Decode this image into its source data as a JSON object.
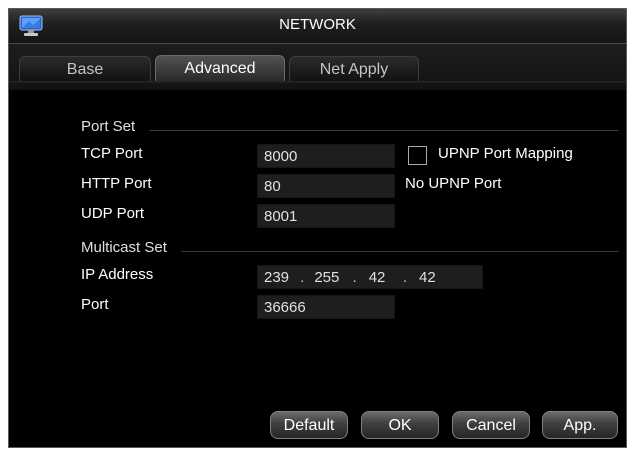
{
  "window": {
    "title": "NETWORK",
    "icon": "network-monitor-icon"
  },
  "tabs": [
    {
      "label": "Base",
      "active": false
    },
    {
      "label": "Advanced",
      "active": true
    },
    {
      "label": "Net Apply",
      "active": false
    }
  ],
  "port_set": {
    "section_label": "Port Set",
    "tcp_port": {
      "label": "TCP Port",
      "value": "8000"
    },
    "http_port": {
      "label": "HTTP Port",
      "value": "80"
    },
    "udp_port": {
      "label": "UDP Port",
      "value": "8001"
    },
    "upnp": {
      "checkbox_label": "UPNP Port Mapping",
      "checked": false,
      "status_text": "No UPNP Port"
    }
  },
  "multicast_set": {
    "section_label": "Multicast Set",
    "ip_address": {
      "label": "IP Address",
      "octets": [
        "239",
        "255",
        "42",
        "42"
      ],
      "separator": "."
    },
    "port": {
      "label": "Port",
      "value": "36666"
    }
  },
  "buttons": {
    "default": "Default",
    "ok": "OK",
    "cancel": "Cancel",
    "apply": "App."
  },
  "colors": {
    "background": "#000000",
    "field": "#1e1e1e",
    "text": "#ffffff"
  }
}
